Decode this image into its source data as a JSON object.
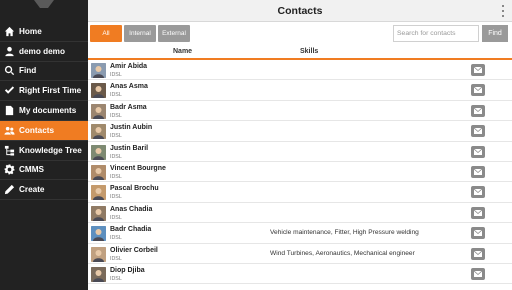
{
  "app": {
    "title": "Contacts"
  },
  "sidebar": {
    "items": [
      {
        "label": "Home",
        "icon": "home-icon",
        "active": false
      },
      {
        "label": "demo demo",
        "icon": "user-icon",
        "active": false
      },
      {
        "label": "Find",
        "icon": "search-icon",
        "active": false
      },
      {
        "label": "Right First Time",
        "icon": "checkmark-icon",
        "active": false
      },
      {
        "label": "My documents",
        "icon": "document-icon",
        "active": false
      },
      {
        "label": "Contacts",
        "icon": "contacts-icon",
        "active": true
      },
      {
        "label": "Knowledge Tree",
        "icon": "tree-icon",
        "active": false
      },
      {
        "label": "CMMS",
        "icon": "gear-icon",
        "active": false
      },
      {
        "label": "Create",
        "icon": "pencil-icon",
        "active": false
      }
    ]
  },
  "filters": {
    "all": "All",
    "internal": "Internal",
    "external": "External",
    "selected": "All"
  },
  "search": {
    "placeholder": "Search for contacts",
    "value": "",
    "button": "Find"
  },
  "table": {
    "columns": {
      "name": "Name",
      "skills": "Skills"
    },
    "rows": [
      {
        "name": "Amir Abida",
        "company": "IDSL",
        "skills": ""
      },
      {
        "name": "Anas Asma",
        "company": "IDSL",
        "skills": ""
      },
      {
        "name": "Badr Asma",
        "company": "IDSL",
        "skills": ""
      },
      {
        "name": "Justin Aubin",
        "company": "IDSL",
        "skills": ""
      },
      {
        "name": "Justin Baril",
        "company": "IDSL",
        "skills": ""
      },
      {
        "name": "Vincent Bourgne",
        "company": "IDSL",
        "skills": ""
      },
      {
        "name": "Pascal Brochu",
        "company": "IDSL",
        "skills": ""
      },
      {
        "name": "Anas Chadia",
        "company": "IDSL",
        "skills": ""
      },
      {
        "name": "Badr Chadia",
        "company": "IDSL",
        "skills": "Vehicle maintenance, Fitter, High Pressure welding"
      },
      {
        "name": "Olivier Corbeil",
        "company": "IDSL",
        "skills": "Wind Turbines, Aeronautics, Mechanical engineer"
      },
      {
        "name": "Diop Djiba",
        "company": "IDSL",
        "skills": ""
      }
    ]
  },
  "colors": {
    "accent": "#f07c22",
    "sidebar": "#222222",
    "button_gray": "#9a9a9a"
  }
}
